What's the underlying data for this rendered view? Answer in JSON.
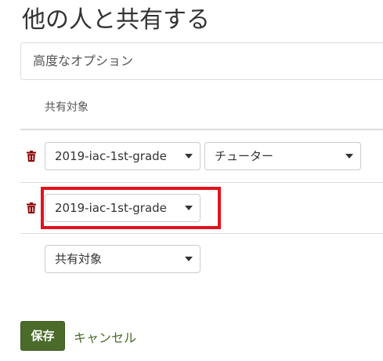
{
  "page": {
    "title": "他の人と共有する"
  },
  "advanced": {
    "label": "高度なオプション"
  },
  "share_table": {
    "header_label": "共有対象",
    "rows": [
      {
        "target": "2019-iac-1st-grade",
        "role": "チューター"
      },
      {
        "target": "2019-iac-1st-grade"
      }
    ],
    "new_row": {
      "placeholder": "共有対象"
    }
  },
  "actions": {
    "save_label": "保存",
    "cancel_label": "キャンセル"
  },
  "colors": {
    "save_button": "#4a6b2a",
    "highlight_border": "#e0141e",
    "trash_icon": "#8b0000"
  },
  "icons": {
    "delete": "trash-icon",
    "dropdown": "caret-down-icon"
  }
}
